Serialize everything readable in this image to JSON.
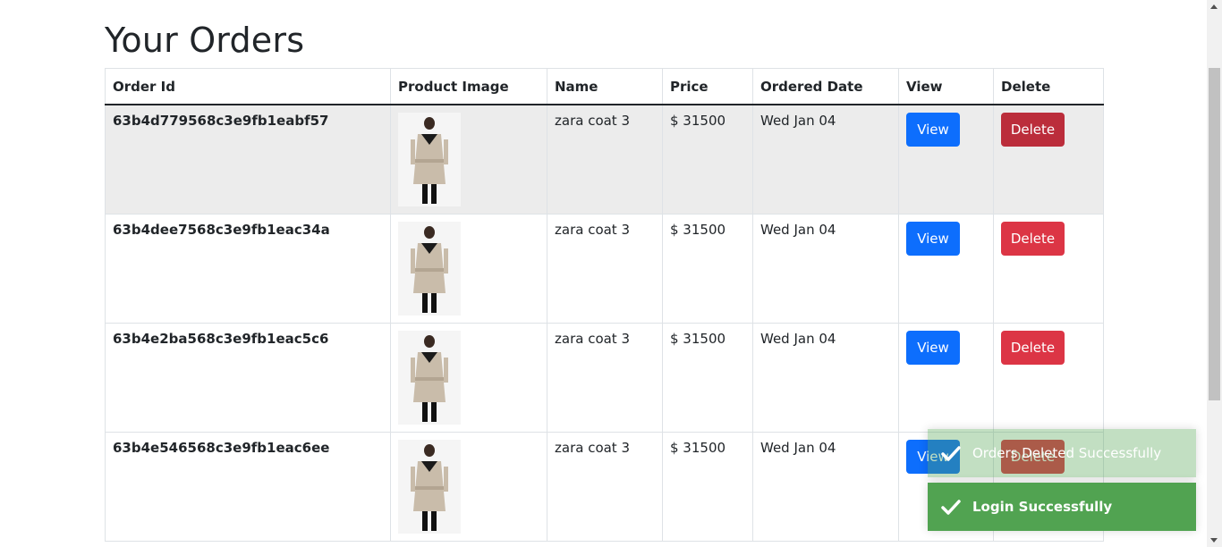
{
  "page": {
    "title": "Your Orders"
  },
  "table": {
    "headers": [
      "Order Id",
      "Product Image",
      "Name",
      "Price",
      "Ordered Date",
      "View",
      "Delete"
    ],
    "rows": [
      {
        "order_id": "63b4d779568c3e9fb1eabf57",
        "name": "zara coat 3",
        "price": "$ 31500",
        "date": "Wed Jan 04",
        "view": "View",
        "delete": "Delete"
      },
      {
        "order_id": "63b4dee7568c3e9fb1eac34a",
        "name": "zara coat 3",
        "price": "$ 31500",
        "date": "Wed Jan 04",
        "view": "View",
        "delete": "Delete"
      },
      {
        "order_id": "63b4e2ba568c3e9fb1eac5c6",
        "name": "zara coat 3",
        "price": "$ 31500",
        "date": "Wed Jan 04",
        "view": "View",
        "delete": "Delete"
      },
      {
        "order_id": "63b4e546568c3e9fb1eac6ee",
        "name": "zara coat 3",
        "price": "$ 31500",
        "date": "Wed Jan 04",
        "view": "View",
        "delete": "Delete"
      }
    ]
  },
  "toasts": [
    {
      "text": "Orders Deleted Successfully",
      "icon": "check-icon",
      "state": "fading"
    },
    {
      "text": "Login Successfully",
      "icon": "check-icon",
      "state": "visible"
    }
  ],
  "colors": {
    "primary": "#0d6efd",
    "danger": "#dc3545",
    "success": "#51a351"
  }
}
